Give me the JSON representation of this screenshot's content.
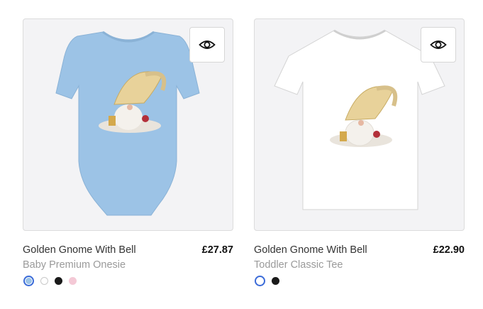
{
  "products": [
    {
      "title": "Golden Gnome With Bell",
      "subtitle": "Baby Premium Onesie",
      "price": "£27.87",
      "quick_view_icon": "eye-icon",
      "garment_color": "#9cc3e6",
      "swatches": [
        {
          "name": "light-blue",
          "color": "#9cc3e6",
          "selected": true
        },
        {
          "name": "white",
          "color": "#ffffff",
          "selected": false
        },
        {
          "name": "black",
          "color": "#1a1a1a",
          "selected": false
        },
        {
          "name": "pink",
          "color": "#f4c9d6",
          "selected": false
        }
      ]
    },
    {
      "title": "Golden Gnome With Bell",
      "subtitle": "Toddler Classic Tee",
      "price": "£22.90",
      "quick_view_icon": "eye-icon",
      "garment_color": "#ffffff",
      "swatches": [
        {
          "name": "white",
          "color": "#ffffff",
          "selected": true
        },
        {
          "name": "black",
          "color": "#1a1a1a",
          "selected": false
        }
      ]
    }
  ]
}
